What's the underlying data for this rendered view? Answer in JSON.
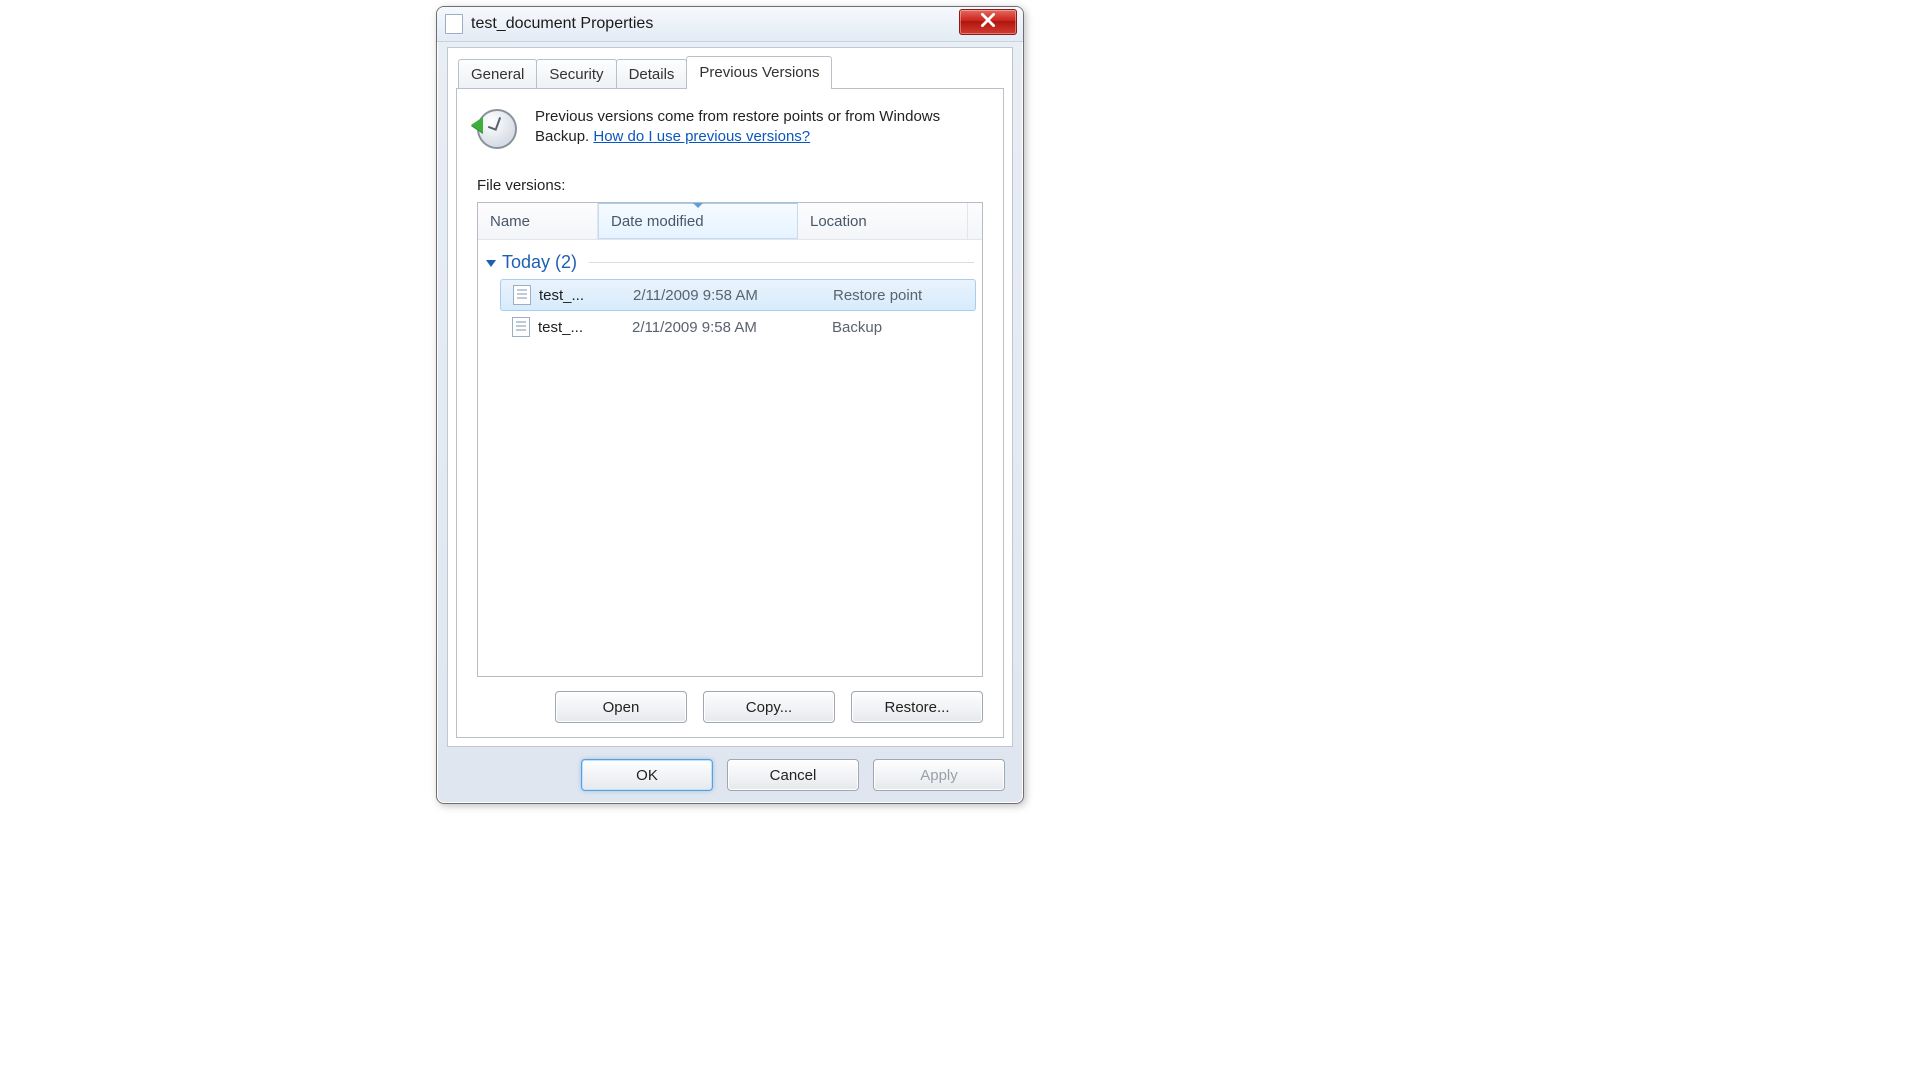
{
  "window": {
    "title": "test_document Properties"
  },
  "tabs": [
    {
      "label": "General"
    },
    {
      "label": "Security"
    },
    {
      "label": "Details"
    },
    {
      "label": "Previous Versions"
    }
  ],
  "intro": {
    "text_a": "Previous versions come from restore points or from Windows Backup. ",
    "link": "How do I use previous versions?"
  },
  "section_label": "File versions:",
  "columns": {
    "name": "Name",
    "date": "Date modified",
    "location": "Location"
  },
  "group": {
    "label": "Today (2)"
  },
  "rows": [
    {
      "name": "test_...",
      "date": "2/11/2009 9:58 AM",
      "location": "Restore point",
      "selected": true
    },
    {
      "name": "test_...",
      "date": "2/11/2009 9:58 AM",
      "location": "Backup",
      "selected": false
    }
  ],
  "actions": {
    "open": "Open",
    "copy": "Copy...",
    "restore": "Restore..."
  },
  "dialog_buttons": {
    "ok": "OK",
    "cancel": "Cancel",
    "apply": "Apply"
  }
}
